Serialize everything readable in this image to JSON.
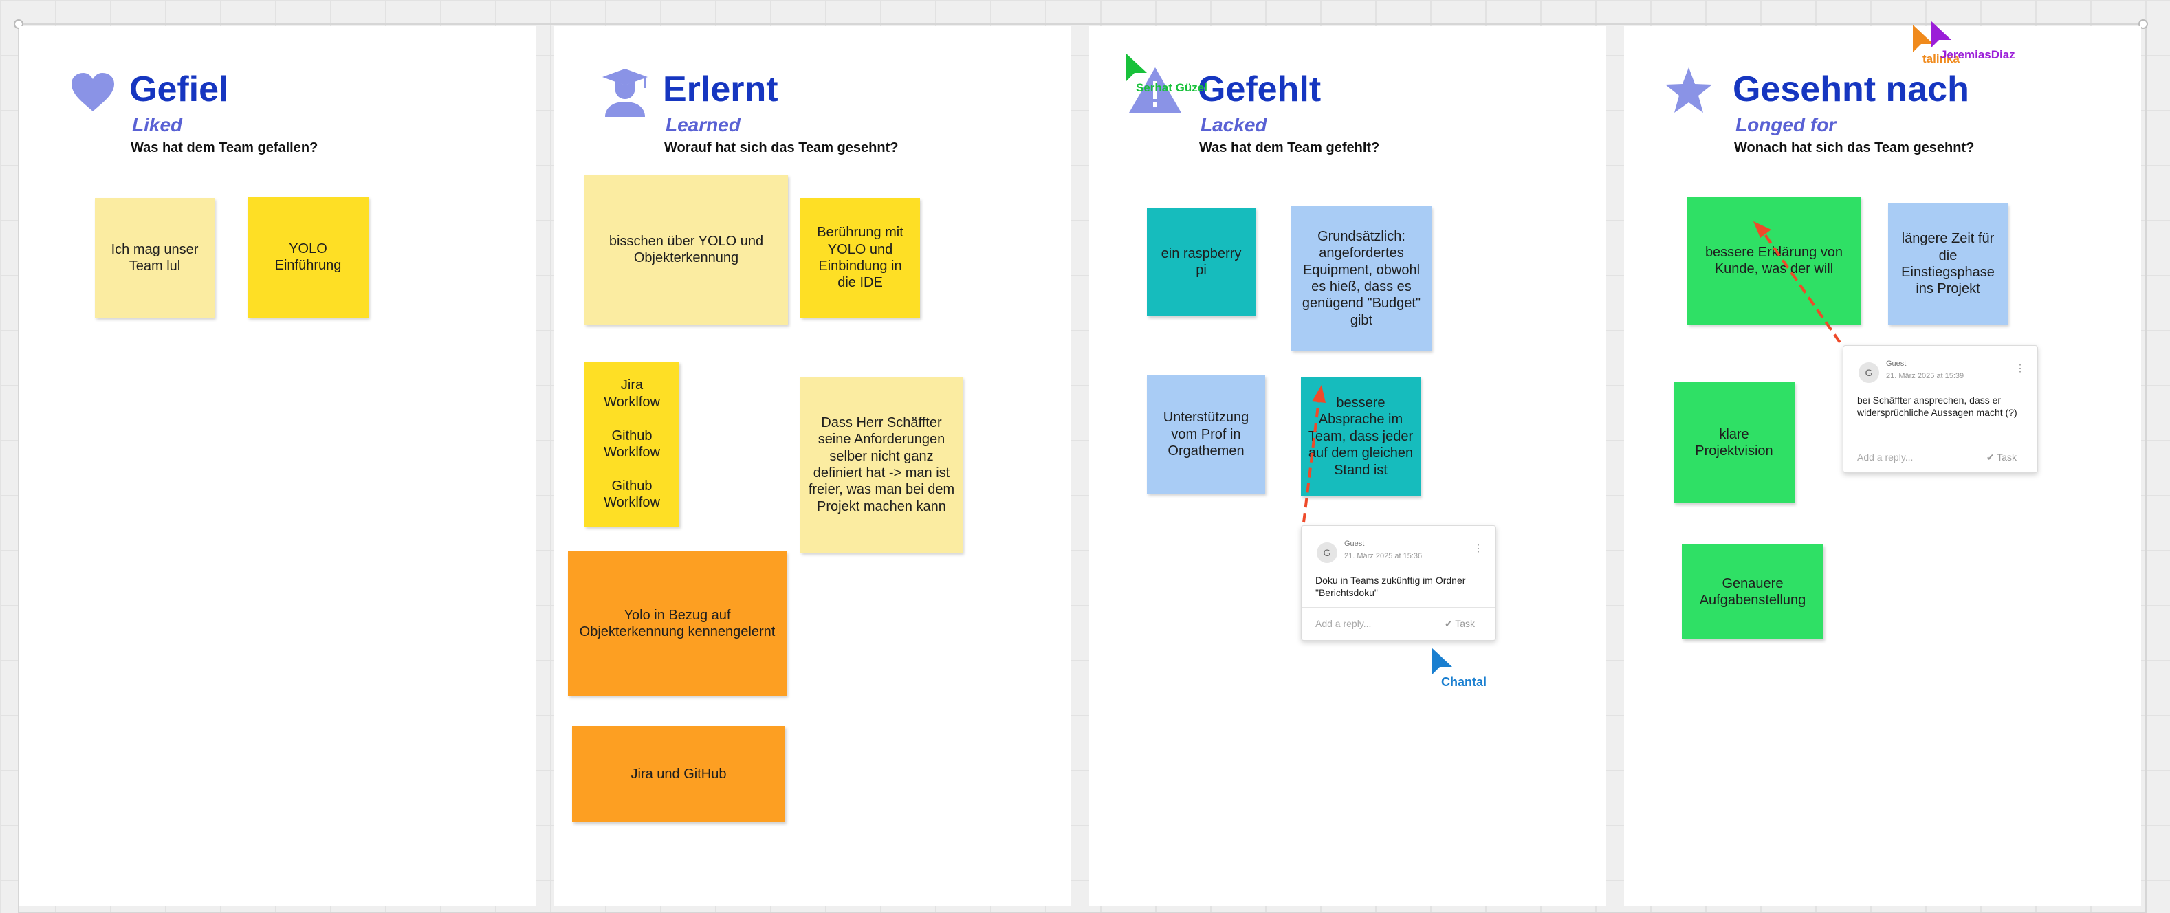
{
  "columns": [
    {
      "title": "Gefiel",
      "subtitle": "Liked",
      "question": "Was hat dem Team gefallen?",
      "icon": "heart-icon"
    },
    {
      "title": "Erlernt",
      "subtitle": "Learned",
      "question": "Worauf hat sich das Team gesehnt?",
      "icon": "graduate-icon"
    },
    {
      "title": "Gefehlt",
      "subtitle": "Lacked",
      "question": "Was hat dem Team gefehlt?",
      "icon": "warning-triangle-icon"
    },
    {
      "title": "Gesehnt nach",
      "subtitle": "Longed for",
      "question": "Wonach hat sich das Team gesehnt?",
      "icon": "star-icon"
    }
  ],
  "notes": {
    "liked": [
      {
        "text": "Ich mag unser\nTeam lul",
        "color": "pale"
      },
      {
        "text": "YOLO Einführung",
        "color": "yellow"
      }
    ],
    "learned": [
      {
        "text": "bisschen über YOLO und\nObjekterkennung",
        "color": "pale"
      },
      {
        "text": "Berührung mit\nYOLO und\nEinbindung in\ndie IDE",
        "color": "yellow"
      },
      {
        "text": "Jira Worklfow\n\nGithub\nWorklfow\n\nGithub\nWorklfow",
        "color": "yellow"
      },
      {
        "text": "Dass Herr Schäffter\nseine Anforderungen\nselber nicht ganz\ndefiniert hat -> man ist\nfreier, was man bei dem\nProjekt machen kann",
        "color": "pale"
      },
      {
        "text": "Yolo in Bezug auf\nObjekterkennung kennengelernt",
        "color": "orange"
      },
      {
        "text": "Jira und GitHub",
        "color": "orange"
      }
    ],
    "lacked": [
      {
        "text": "ein raspberry\npi",
        "color": "teal"
      },
      {
        "text": "Grundsätzlich:\nangefordertes\nEquipment, obwohl\nes hieß, dass es\ngenügend \"Budget\"\ngibt",
        "color": "blue"
      },
      {
        "text": "Unterstützung\nvom Prof in\nOrgathemen",
        "color": "blue"
      },
      {
        "text": "bessere\nAbsprache im\nTeam, dass jeder\nauf dem gleichen\nStand ist",
        "color": "teal"
      }
    ],
    "longed": [
      {
        "text": "bessere Erklärung von\nKunde, was der will",
        "color": "green"
      },
      {
        "text": "längere Zeit für\ndie\nEinstiegsphase\nins Projekt",
        "color": "blue"
      },
      {
        "text": "klare\nProjektvision",
        "color": "green"
      },
      {
        "text": "Genauere\nAufgabenstellung",
        "color": "green"
      }
    ]
  },
  "comments": [
    {
      "avatar": "G",
      "author": "Guest",
      "time": "21. März 2025 at 15:36",
      "text": "Doku in Teams zukünftig im Ordner \"Berichtsdoku\"",
      "reply_placeholder": "Add a reply...",
      "task_label": "Task",
      "menu": "⋮"
    },
    {
      "avatar": "G",
      "author": "Guest",
      "time": "21. März 2025 at 15:39",
      "text": "bei Schäffter ansprechen, dass er widersprüchliche Aussagen macht (?)",
      "reply_placeholder": "Add a reply...",
      "task_label": "Task",
      "menu": "⋮"
    }
  ],
  "cursors": [
    {
      "name": "Serhat Güzel",
      "color": "#18c13a"
    },
    {
      "name": "Chantal",
      "color": "#1a7fd0"
    },
    {
      "name": "talinka",
      "color": "#f08a1c"
    },
    {
      "name": "JeremiasDiaz",
      "color": "#9b1ed8"
    }
  ],
  "colors": {
    "title": "#1636c0",
    "subtitle": "#5961d4",
    "icon": "#8a93e6",
    "arrow": "#ee4a2a"
  }
}
